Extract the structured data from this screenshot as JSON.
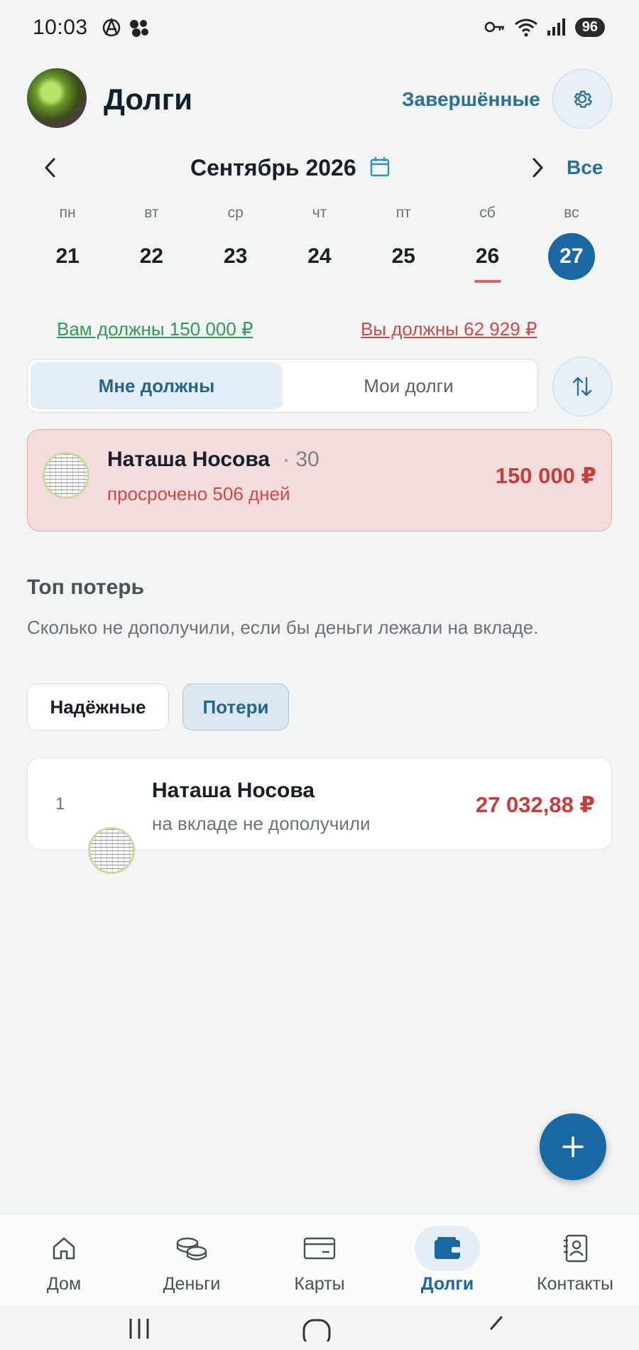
{
  "status_bar": {
    "time": "10:03",
    "battery": "96"
  },
  "header": {
    "title": "Долги",
    "completed_label": "Завершённые"
  },
  "calendar": {
    "month_label": "Сентябрь 2026",
    "all_label": "Все",
    "days": [
      {
        "name": "пн",
        "num": "21"
      },
      {
        "name": "вт",
        "num": "22"
      },
      {
        "name": "ср",
        "num": "23"
      },
      {
        "name": "чт",
        "num": "24"
      },
      {
        "name": "пт",
        "num": "25"
      },
      {
        "name": "сб",
        "num": "26"
      },
      {
        "name": "вс",
        "num": "27"
      }
    ],
    "today_index": 5,
    "selected_index": 6
  },
  "totals": {
    "owed_to_you": "Вам должны 150 000 ₽",
    "you_owe": "Вы должны 62 929 ₽"
  },
  "tabs": {
    "owed_to_me": "Мне должны",
    "my_debts": "Мои долги"
  },
  "debts": [
    {
      "name": "Наташа Носова",
      "count": "· 30",
      "status": "просрочено 506 дней",
      "amount": "150 000 ₽"
    }
  ],
  "losses": {
    "title": "Топ потерь",
    "description": "Сколько не дополучили, если бы деньги лежали на вкладе.",
    "chip_reliable": "Надёжные",
    "chip_losses": "Потери",
    "items": [
      {
        "rank": "1",
        "name": "Наташа Носова",
        "subtitle": "на вкладе не дополучили",
        "amount": "27 032,88 ₽"
      }
    ]
  },
  "bottom_nav": [
    {
      "label": "Дом",
      "icon": "home-icon"
    },
    {
      "label": "Деньги",
      "icon": "coins-icon"
    },
    {
      "label": "Карты",
      "icon": "card-icon"
    },
    {
      "label": "Долги",
      "icon": "wallet-icon"
    },
    {
      "label": "Контакты",
      "icon": "contacts-icon"
    }
  ],
  "active_nav_index": 3,
  "colors": {
    "accent": "#1968a4",
    "positive": "#2f9a5c",
    "negative": "#d04848",
    "overdue_card_bg": "#f4dcdc"
  }
}
